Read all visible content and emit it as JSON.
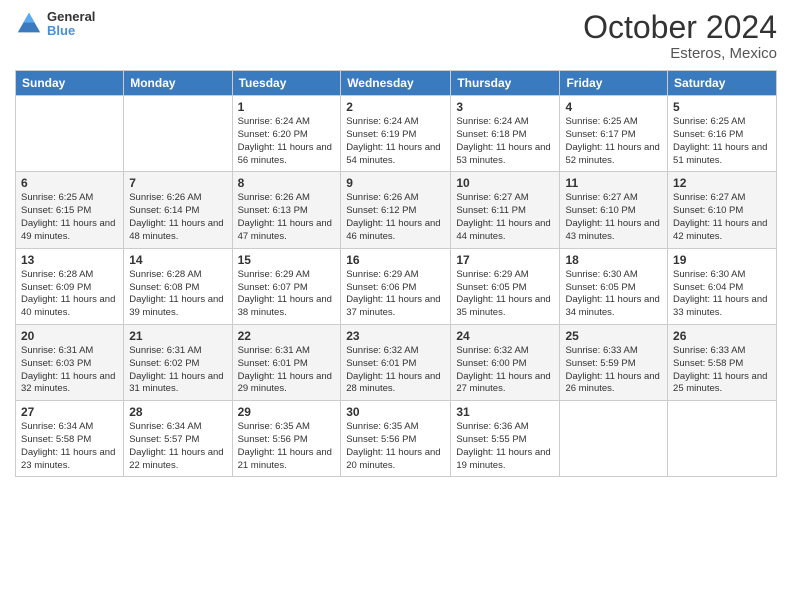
{
  "header": {
    "logo_line1": "General",
    "logo_line2": "Blue",
    "month": "October 2024",
    "location": "Esteros, Mexico"
  },
  "weekdays": [
    "Sunday",
    "Monday",
    "Tuesday",
    "Wednesday",
    "Thursday",
    "Friday",
    "Saturday"
  ],
  "weeks": [
    [
      {
        "day": "",
        "info": ""
      },
      {
        "day": "",
        "info": ""
      },
      {
        "day": "1",
        "info": "Sunrise: 6:24 AM\nSunset: 6:20 PM\nDaylight: 11 hours and 56 minutes."
      },
      {
        "day": "2",
        "info": "Sunrise: 6:24 AM\nSunset: 6:19 PM\nDaylight: 11 hours and 54 minutes."
      },
      {
        "day": "3",
        "info": "Sunrise: 6:24 AM\nSunset: 6:18 PM\nDaylight: 11 hours and 53 minutes."
      },
      {
        "day": "4",
        "info": "Sunrise: 6:25 AM\nSunset: 6:17 PM\nDaylight: 11 hours and 52 minutes."
      },
      {
        "day": "5",
        "info": "Sunrise: 6:25 AM\nSunset: 6:16 PM\nDaylight: 11 hours and 51 minutes."
      }
    ],
    [
      {
        "day": "6",
        "info": "Sunrise: 6:25 AM\nSunset: 6:15 PM\nDaylight: 11 hours and 49 minutes."
      },
      {
        "day": "7",
        "info": "Sunrise: 6:26 AM\nSunset: 6:14 PM\nDaylight: 11 hours and 48 minutes."
      },
      {
        "day": "8",
        "info": "Sunrise: 6:26 AM\nSunset: 6:13 PM\nDaylight: 11 hours and 47 minutes."
      },
      {
        "day": "9",
        "info": "Sunrise: 6:26 AM\nSunset: 6:12 PM\nDaylight: 11 hours and 46 minutes."
      },
      {
        "day": "10",
        "info": "Sunrise: 6:27 AM\nSunset: 6:11 PM\nDaylight: 11 hours and 44 minutes."
      },
      {
        "day": "11",
        "info": "Sunrise: 6:27 AM\nSunset: 6:10 PM\nDaylight: 11 hours and 43 minutes."
      },
      {
        "day": "12",
        "info": "Sunrise: 6:27 AM\nSunset: 6:10 PM\nDaylight: 11 hours and 42 minutes."
      }
    ],
    [
      {
        "day": "13",
        "info": "Sunrise: 6:28 AM\nSunset: 6:09 PM\nDaylight: 11 hours and 40 minutes."
      },
      {
        "day": "14",
        "info": "Sunrise: 6:28 AM\nSunset: 6:08 PM\nDaylight: 11 hours and 39 minutes."
      },
      {
        "day": "15",
        "info": "Sunrise: 6:29 AM\nSunset: 6:07 PM\nDaylight: 11 hours and 38 minutes."
      },
      {
        "day": "16",
        "info": "Sunrise: 6:29 AM\nSunset: 6:06 PM\nDaylight: 11 hours and 37 minutes."
      },
      {
        "day": "17",
        "info": "Sunrise: 6:29 AM\nSunset: 6:05 PM\nDaylight: 11 hours and 35 minutes."
      },
      {
        "day": "18",
        "info": "Sunrise: 6:30 AM\nSunset: 6:05 PM\nDaylight: 11 hours and 34 minutes."
      },
      {
        "day": "19",
        "info": "Sunrise: 6:30 AM\nSunset: 6:04 PM\nDaylight: 11 hours and 33 minutes."
      }
    ],
    [
      {
        "day": "20",
        "info": "Sunrise: 6:31 AM\nSunset: 6:03 PM\nDaylight: 11 hours and 32 minutes."
      },
      {
        "day": "21",
        "info": "Sunrise: 6:31 AM\nSunset: 6:02 PM\nDaylight: 11 hours and 31 minutes."
      },
      {
        "day": "22",
        "info": "Sunrise: 6:31 AM\nSunset: 6:01 PM\nDaylight: 11 hours and 29 minutes."
      },
      {
        "day": "23",
        "info": "Sunrise: 6:32 AM\nSunset: 6:01 PM\nDaylight: 11 hours and 28 minutes."
      },
      {
        "day": "24",
        "info": "Sunrise: 6:32 AM\nSunset: 6:00 PM\nDaylight: 11 hours and 27 minutes."
      },
      {
        "day": "25",
        "info": "Sunrise: 6:33 AM\nSunset: 5:59 PM\nDaylight: 11 hours and 26 minutes."
      },
      {
        "day": "26",
        "info": "Sunrise: 6:33 AM\nSunset: 5:58 PM\nDaylight: 11 hours and 25 minutes."
      }
    ],
    [
      {
        "day": "27",
        "info": "Sunrise: 6:34 AM\nSunset: 5:58 PM\nDaylight: 11 hours and 23 minutes."
      },
      {
        "day": "28",
        "info": "Sunrise: 6:34 AM\nSunset: 5:57 PM\nDaylight: 11 hours and 22 minutes."
      },
      {
        "day": "29",
        "info": "Sunrise: 6:35 AM\nSunset: 5:56 PM\nDaylight: 11 hours and 21 minutes."
      },
      {
        "day": "30",
        "info": "Sunrise: 6:35 AM\nSunset: 5:56 PM\nDaylight: 11 hours and 20 minutes."
      },
      {
        "day": "31",
        "info": "Sunrise: 6:36 AM\nSunset: 5:55 PM\nDaylight: 11 hours and 19 minutes."
      },
      {
        "day": "",
        "info": ""
      },
      {
        "day": "",
        "info": ""
      }
    ]
  ]
}
